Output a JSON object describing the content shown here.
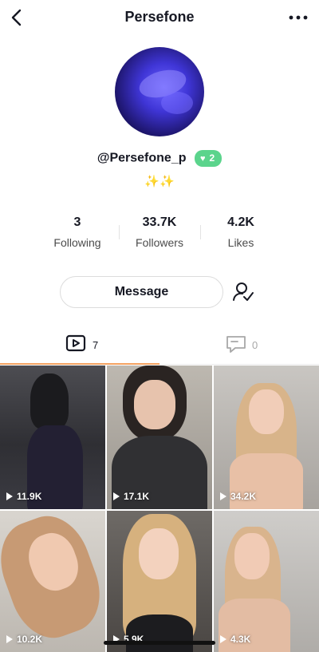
{
  "header": {
    "title": "Persefone",
    "back_icon": "chevron-left-icon",
    "more_icon": "more-horizontal-icon"
  },
  "profile": {
    "handle": "@Persefone_p",
    "badge": {
      "icon": "heart-icon",
      "value": "2",
      "color": "#5bd48c"
    },
    "bio": "✨✨"
  },
  "stats": [
    {
      "value": "3",
      "label": "Following"
    },
    {
      "value": "33.7K",
      "label": "Followers"
    },
    {
      "value": "4.2K",
      "label": "Likes"
    }
  ],
  "actions": {
    "message_label": "Message",
    "follow_icon": "person-check-icon"
  },
  "tabs": [
    {
      "icon": "play-box-icon",
      "count": "7",
      "active": true
    },
    {
      "icon": "comment-box-icon",
      "count": "0",
      "active": false
    }
  ],
  "videos": [
    {
      "views": "11.9K"
    },
    {
      "views": "17.1K"
    },
    {
      "views": "34.2K"
    },
    {
      "views": "10.2K"
    },
    {
      "views": "5.9K"
    },
    {
      "views": "4.3K"
    }
  ],
  "colors": {
    "accent_tab": "#f4a261",
    "badge": "#5bd48c"
  }
}
